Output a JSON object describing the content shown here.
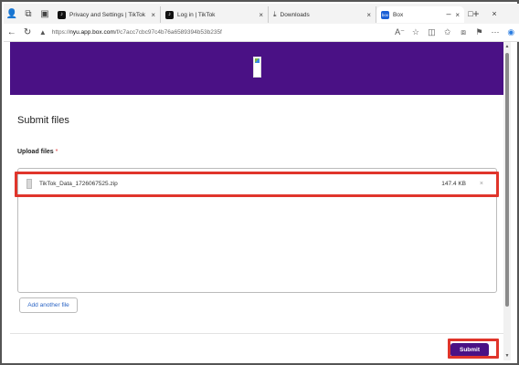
{
  "tabs": [
    {
      "title": "Privacy and Settings | TikTok",
      "favicon": "tiktok-icon"
    },
    {
      "title": "Log in | TikTok",
      "favicon": "tiktok-icon"
    },
    {
      "title": "Downloads",
      "favicon": "download-icon"
    },
    {
      "title": "Box",
      "favicon": "box-icon",
      "favicon_text": "box",
      "active": true
    }
  ],
  "address_bar": {
    "prefix": "https://",
    "host": "nyu.app.box.com",
    "path": "/f/c7acc7cbc97c4b76a6589394b53b235f"
  },
  "page": {
    "title": "Submit files",
    "upload_label": "Upload files",
    "required_marker": "*",
    "file": {
      "name": "TikTok_Data_1726067525.zip",
      "size": "147.4 KB",
      "remove_glyph": "×"
    },
    "add_another_label": "Add another file",
    "submit_label": "Submit"
  },
  "colors": {
    "brand_purple": "#4a1185",
    "highlight_red": "#e0352b",
    "link_blue": "#2a64c5"
  }
}
